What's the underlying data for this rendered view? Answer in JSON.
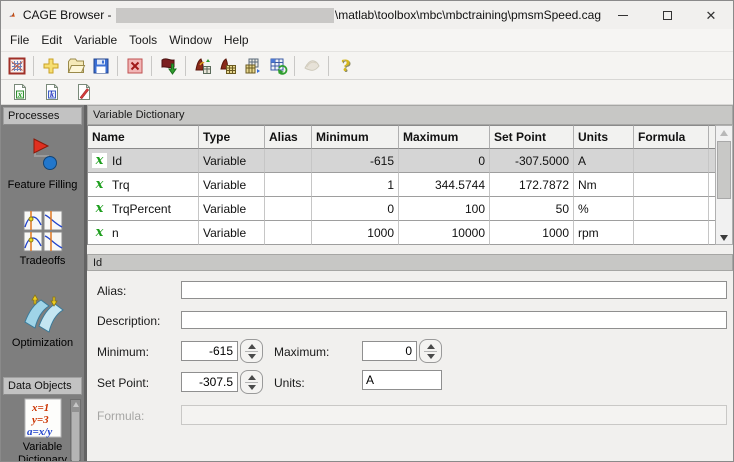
{
  "window": {
    "title_prefix": "CAGE Browser - ",
    "title_path": "\\matlab\\toolbox\\mbc\\mbctraining\\pmsmSpeed.cag",
    "controls": [
      "minimize",
      "maximize",
      "close"
    ]
  },
  "menu_bar": {
    "items": [
      "File",
      "Edit",
      "Variable",
      "Tools",
      "Window",
      "Help"
    ]
  },
  "main_toolbar": {
    "icons": [
      "cage-project",
      "new-file",
      "open-folder",
      "save",
      "delete",
      "import-data",
      "import-calibration",
      "calibration-table",
      "copy-calibration-tables",
      "export-calibration-table",
      "surface-view-disabled",
      "help"
    ]
  },
  "dictionary_toolbar": {
    "icons": [
      "new-variable",
      "new-constant",
      "new-formula"
    ]
  },
  "sidebar": {
    "sections": [
      {
        "header": "Processes",
        "items": [
          {
            "label": "Feature Filling",
            "icon": "feature-filling-icon"
          },
          {
            "label": "Tradeoffs",
            "icon": "tradeoffs-icon"
          },
          {
            "label": "Optimization",
            "icon": "optimization-icon"
          }
        ]
      },
      {
        "header": "Data Objects",
        "items": [
          {
            "label": "Variable Dictionary",
            "label_line1": "Variable",
            "label_line2": "Dictionary",
            "icon": "variable-dictionary-icon"
          }
        ]
      }
    ]
  },
  "variable_table": {
    "title": "Variable Dictionary",
    "variable_icon_glyph": "x",
    "columns": [
      "Name",
      "Type",
      "Alias",
      "Minimum",
      "Maximum",
      "Set Point",
      "Units",
      "Formula"
    ],
    "rows": [
      {
        "name": "Id",
        "type": "Variable",
        "alias": "",
        "minimum": "-615",
        "maximum": "0",
        "set_point": "-307.5000",
        "units": "A",
        "formula": "",
        "selected": true
      },
      {
        "name": "Trq",
        "type": "Variable",
        "alias": "",
        "minimum": "1",
        "maximum": "344.5744",
        "set_point": "172.7872",
        "units": "Nm",
        "formula": "",
        "selected": false
      },
      {
        "name": "TrqPercent",
        "type": "Variable",
        "alias": "",
        "minimum": "0",
        "maximum": "100",
        "set_point": "50",
        "units": "%",
        "formula": "",
        "selected": false
      },
      {
        "name": "n",
        "type": "Variable",
        "alias": "",
        "minimum": "1000",
        "maximum": "10000",
        "set_point": "1000",
        "units": "rpm",
        "formula": "",
        "selected": false
      }
    ]
  },
  "detail_panel": {
    "title": "Id",
    "alias": {
      "label": "Alias:",
      "value": ""
    },
    "description": {
      "label": "Description:",
      "value": ""
    },
    "minimum": {
      "label": "Minimum:",
      "value": "-615"
    },
    "maximum": {
      "label": "Maximum:",
      "value": "0"
    },
    "set_point": {
      "label": "Set Point:",
      "value": "-307.5"
    },
    "units": {
      "label": "Units:",
      "value": "A"
    },
    "formula": {
      "label": "Formula:",
      "value": "",
      "disabled": true
    }
  }
}
